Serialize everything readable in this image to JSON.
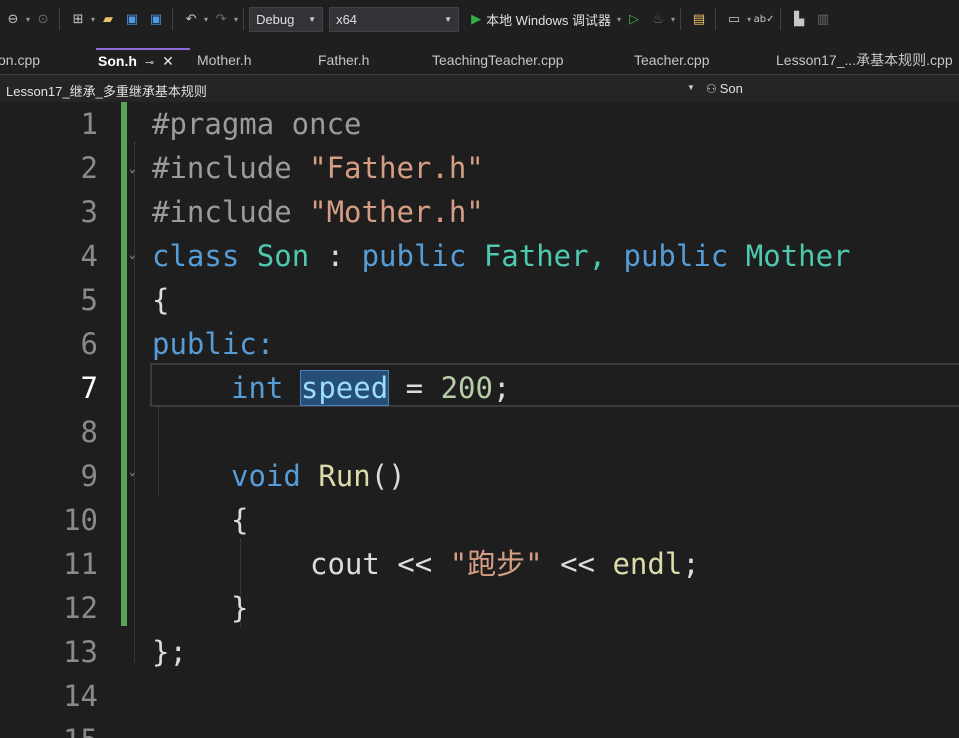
{
  "toolbar": {
    "configuration": "Debug",
    "platform": "x64",
    "run_label": "本地 Windows 调试器"
  },
  "tabs": [
    {
      "label": "on.cpp"
    },
    {
      "label": "Son.h"
    },
    {
      "label": "Mother.h"
    },
    {
      "label": "Father.h"
    },
    {
      "label": "TeachingTeacher.cpp"
    },
    {
      "label": "Teacher.cpp"
    },
    {
      "label": "Lesson17_...承基本规则.cpp"
    }
  ],
  "navbar": {
    "project": "Lesson17_继承_多重继承基本规则",
    "member": "Son"
  },
  "editor": {
    "line_numbers": [
      "1",
      "2",
      "3",
      "4",
      "5",
      "6",
      "7",
      "8",
      "9",
      "10",
      "11",
      "12",
      "13",
      "14",
      "15"
    ],
    "current_line": 7,
    "code": {
      "l1_directive": "#pragma once",
      "l2_directive": "#include ",
      "l2_file": "\"Father.h\"",
      "l3_directive": "#include ",
      "l3_file": "\"Mother.h\"",
      "l4_class_kw": "class",
      "l4_class_name": "Son",
      "l4_colon": ":",
      "l4_public1": "public",
      "l4_base1": "Father,",
      "l4_public2": "public",
      "l4_base2": "Mother",
      "l5_brace": "{",
      "l6_access": "public:",
      "l7_type": "int",
      "l7_var": "speed",
      "l7_assign": " = ",
      "l7_value": "200",
      "l7_semi": ";",
      "l9_void": "void",
      "l9_fn": "Run",
      "l9_parens": "()",
      "l10_brace": "{",
      "l11_cout": "cout << ",
      "l11_str": "\"跑步\"",
      "l11_op": " << ",
      "l11_endl": "endl",
      "l11_semi": ";",
      "l12_brace": "}",
      "l13_end": "};"
    }
  }
}
